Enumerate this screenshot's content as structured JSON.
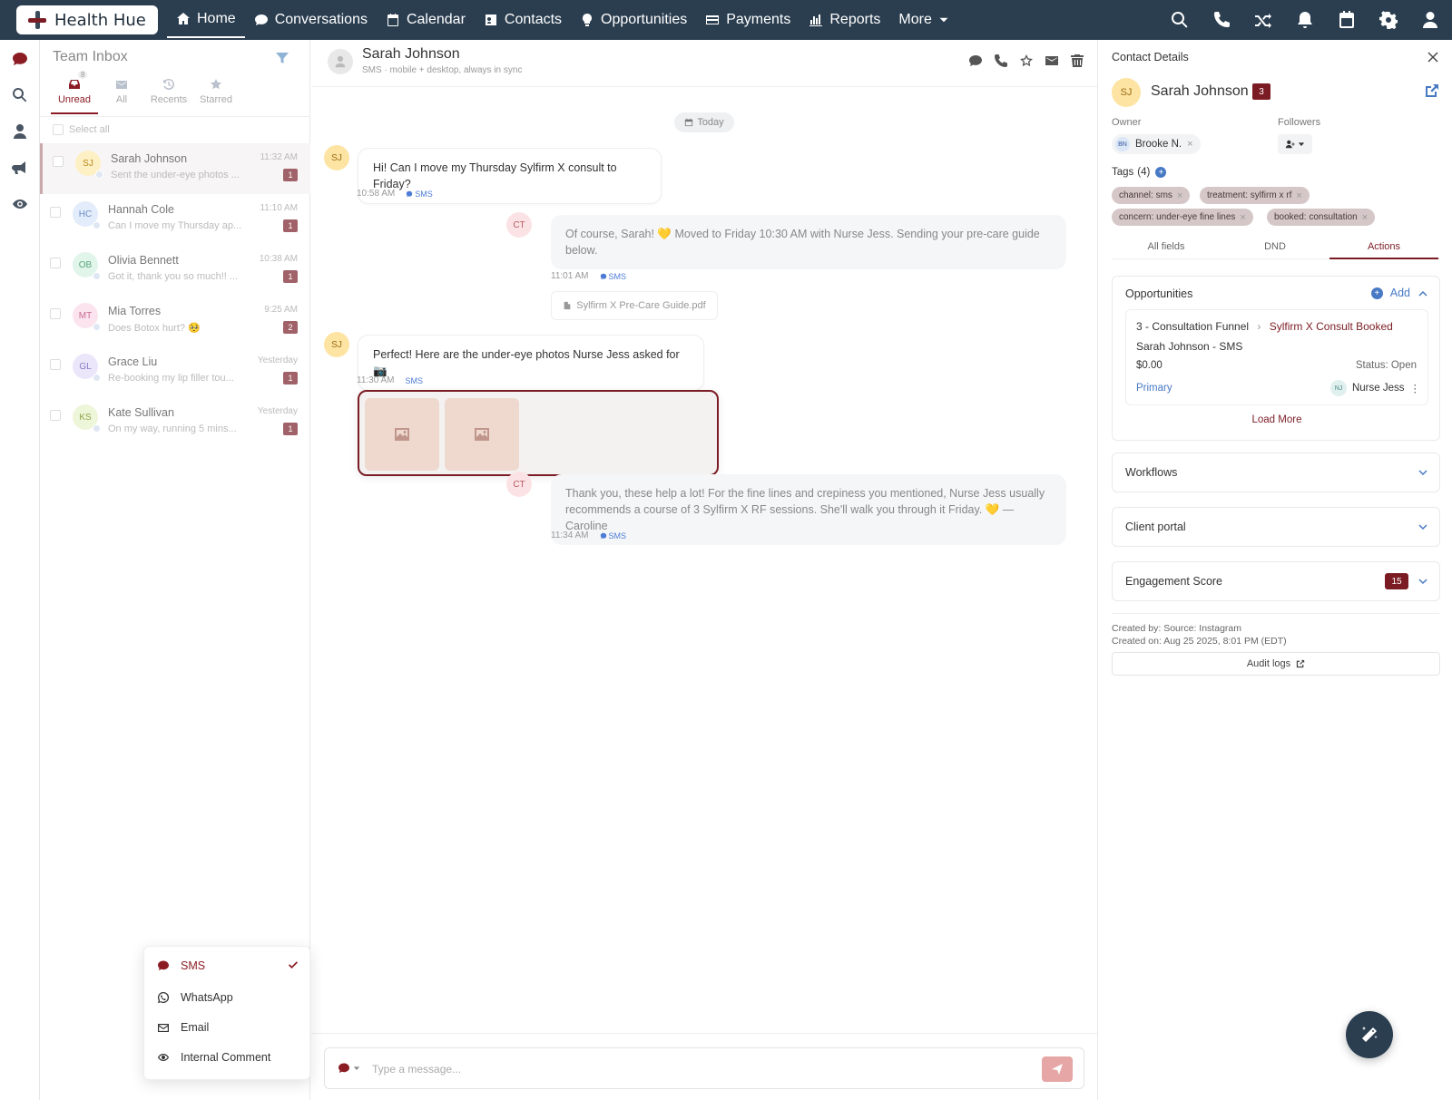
{
  "app": {
    "brand": "Health Hue"
  },
  "nav": {
    "items": [
      {
        "label": "Home",
        "icon": "home-icon"
      },
      {
        "label": "Conversations",
        "icon": "chat-icon"
      },
      {
        "label": "Calendar",
        "icon": "calendar-icon"
      },
      {
        "label": "Contacts",
        "icon": "contact-card-icon"
      },
      {
        "label": "Opportunities",
        "icon": "lightbulb-icon"
      },
      {
        "label": "Payments",
        "icon": "card-icon"
      },
      {
        "label": "Reports",
        "icon": "bar-chart-icon"
      },
      {
        "label": "More",
        "icon": "chevron-down-icon"
      }
    ]
  },
  "inbox": {
    "title": "Team Inbox",
    "tabs": [
      {
        "label": "Unread",
        "badge": "8"
      },
      {
        "label": "All"
      },
      {
        "label": "Recents"
      },
      {
        "label": "Starred"
      }
    ],
    "select_all": "Select all",
    "conversations": [
      {
        "initials": "SJ",
        "name": "Sarah Johnson",
        "snippet": "Sent the under-eye photos ...",
        "time": "11:32 AM",
        "count": "1",
        "bg": "#fdf0c4",
        "fg": "#b88a1c"
      },
      {
        "initials": "HC",
        "name": "Hannah Cole",
        "snippet": "Can I move my Thursday ap...",
        "time": "11:10 AM",
        "count": "1",
        "bg": "#e3ecfa",
        "fg": "#6c8dc6"
      },
      {
        "initials": "OB",
        "name": "Olivia Bennett",
        "snippet": "Got it, thank you so much!! ...",
        "time": "10:38 AM",
        "count": "1",
        "bg": "#e1f5ea",
        "fg": "#5aa67c"
      },
      {
        "initials": "MT",
        "name": "Mia Torres",
        "snippet": "Does Botox hurt? 🥺",
        "time": "9:25 AM",
        "count": "2",
        "bg": "#fbe4ee",
        "fg": "#c86b92"
      },
      {
        "initials": "GL",
        "name": "Grace Liu",
        "snippet": "Re-booking my lip filler tou...",
        "time": "Yesterday",
        "count": "1",
        "bg": "#ebe6fa",
        "fg": "#8a7cc4"
      },
      {
        "initials": "KS",
        "name": "Kate Sullivan",
        "snippet": "On my way, running 5 mins...",
        "time": "Yesterday",
        "count": "1",
        "bg": "#eef6d9",
        "fg": "#8fa34a"
      }
    ]
  },
  "chat": {
    "name": "Sarah Johnson",
    "sub": "SMS · mobile + desktop, always in sync",
    "today": "Today",
    "channel_tag": "SMS",
    "messages": [
      {
        "initials": "SJ",
        "text": "Hi! Can I move my Thursday Sylfirm X consult to Friday?",
        "time": "10:58 AM"
      },
      {
        "initials": "CT",
        "text": "Of course, Sarah! 💛 Moved to Friday 10:30 AM with Nurse Jess. Sending your pre-care guide below.",
        "time": "11:01 AM"
      },
      {
        "initials": "SJ",
        "text": "Perfect! Here are the under-eye photos Nurse Jess asked for 📷",
        "time": "11:30 AM"
      },
      {
        "initials": "CT",
        "text": "Thank you, these help a lot! For the fine lines and crepiness you mentioned, Nurse Jess usually recommends a course of 3 Sylfirm X RF sessions. She'll walk you through it Friday. 💛 — Caroline",
        "time": "11:34 AM"
      }
    ],
    "attachment": "Sylfirm X Pre-Care Guide.pdf",
    "composer_placeholder": "Type a message..."
  },
  "channel_menu": {
    "items": [
      {
        "label": "SMS",
        "icon": "sms-icon",
        "selected": true
      },
      {
        "label": "WhatsApp",
        "icon": "whatsapp-icon"
      },
      {
        "label": "Email",
        "icon": "email-icon"
      },
      {
        "label": "Internal Comment",
        "icon": "eye-icon"
      }
    ]
  },
  "contact": {
    "panel_title": "Contact Details",
    "initials": "SJ",
    "name": "Sarah Johnson",
    "badge": "3",
    "owner_label": "Owner",
    "followers_label": "Followers",
    "owner": {
      "initials": "BN",
      "name": "Brooke N."
    },
    "tags_label": "Tags",
    "tags_count": "(4)",
    "tags": [
      "channel: sms",
      "treatment: sylfirm x rf",
      "concern: under-eye fine lines",
      "booked: consultation"
    ],
    "tabs": [
      "All fields",
      "DND",
      "Actions"
    ],
    "opportunities": {
      "title": "Opportunities",
      "add": "Add",
      "pipeline": "3 - Consultation Funnel",
      "stage": "Sylfirm X Consult Booked",
      "opp_name": "Sarah Johnson - SMS",
      "value": "$0.00",
      "status": "Status: Open",
      "primary": "Primary",
      "assignee_initials": "NJ",
      "assignee": "Nurse Jess",
      "load_more": "Load More"
    },
    "sections": [
      {
        "title": "Workflows"
      },
      {
        "title": "Client portal"
      },
      {
        "title": "Engagement Score",
        "badge": "15"
      }
    ],
    "created_by": "Created by: Source: Instagram",
    "created_on": "Created on: Aug 25 2025, 8:01 PM (EDT)",
    "audit": "Audit logs"
  },
  "colors": {
    "brand": "#7b1c24",
    "topbar": "#2b3e50",
    "sms_tag": "#4e7bd6"
  }
}
